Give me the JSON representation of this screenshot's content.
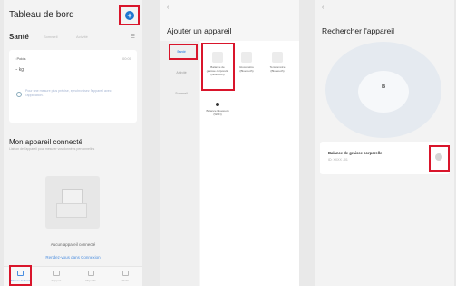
{
  "colors": {
    "accent": "#1f77d0",
    "highlight": "#d9152b",
    "link": "#4d8fe0"
  },
  "panel1": {
    "title": "Tableau de bord",
    "add_icon": "plus-circle-icon",
    "add_symbol": "+",
    "health_label": "Santé",
    "health_tab_a": "Sommeil",
    "health_tab_b": "Activité",
    "menu_symbol": "☰",
    "card": {
      "label_a": "• Poids",
      "label_a_value": "00:00",
      "label_b": "-- kg",
      "note": "Pour une mesure plus précise, synchronisez l'appareil avec l'application."
    },
    "connected_title": "Mon appareil connecté",
    "connected_sub": "Liaison de l'appareil pour mesurer vos données personnelles",
    "empty_text": "Aucun appareil connecté",
    "empty_link": "Rendez-vous dans Connexion",
    "tabs": [
      {
        "label": "Tableau de bord",
        "icon": "dashboard-icon"
      },
      {
        "label": "Rapport",
        "icon": "report-icon"
      },
      {
        "label": "Objectifs",
        "icon": "goals-icon"
      },
      {
        "label": "Profil",
        "icon": "profile-icon"
      }
    ]
  },
  "panel2": {
    "back": "‹",
    "title": "Ajouter un appareil",
    "sidebar": [
      "Santé",
      "Activité",
      "Sommeil"
    ],
    "devices": [
      {
        "label": "Balance de graisse corporelle (Bluetooth)"
      },
      {
        "label": "Glucomètre (Bluetooth)"
      },
      {
        "label": "Tensiomètre (Bluetooth)"
      },
      {
        "label": "Balance Bluetooth (Wi-Fi)"
      }
    ]
  },
  "panel3": {
    "back": "‹",
    "title": "Rechercher l'appareil",
    "bt_symbol": "в",
    "found_name": "Balance de graisse corporelle",
    "found_id": "ID: XXXX - 01"
  }
}
